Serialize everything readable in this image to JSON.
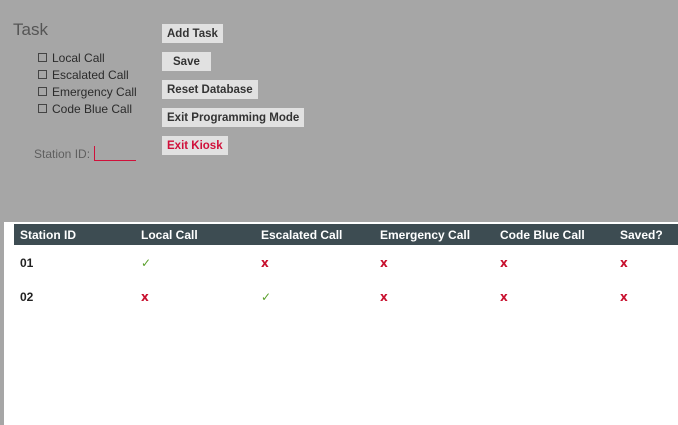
{
  "task": {
    "title": "Task",
    "options": [
      {
        "label": "Local Call",
        "checked": false
      },
      {
        "label": "Escalated Call",
        "checked": false
      },
      {
        "label": "Emergency Call",
        "checked": false
      },
      {
        "label": "Code Blue Call",
        "checked": false
      }
    ],
    "station_label": "Station ID:",
    "station_value": ""
  },
  "buttons": {
    "add_task": "Add Task",
    "save": "Save",
    "reset_database": "Reset Database",
    "exit_programming": "Exit Programming Mode",
    "exit_kiosk": "Exit Kiosk"
  },
  "table": {
    "headers": [
      "Station ID",
      "Local Call",
      "Escalated Call",
      "Emergency Call",
      "Code Blue Call",
      "Saved?"
    ],
    "rows": [
      [
        "01",
        "✓",
        "x",
        "x",
        "x",
        "x"
      ],
      [
        "02",
        "x",
        "✓",
        "x",
        "x",
        "x"
      ]
    ]
  },
  "colors": {
    "panel": "#a6a6a6",
    "header": "#3d4c52",
    "check": "#5aa02c",
    "cross": "#c8102e",
    "accent": "#d0103a"
  }
}
